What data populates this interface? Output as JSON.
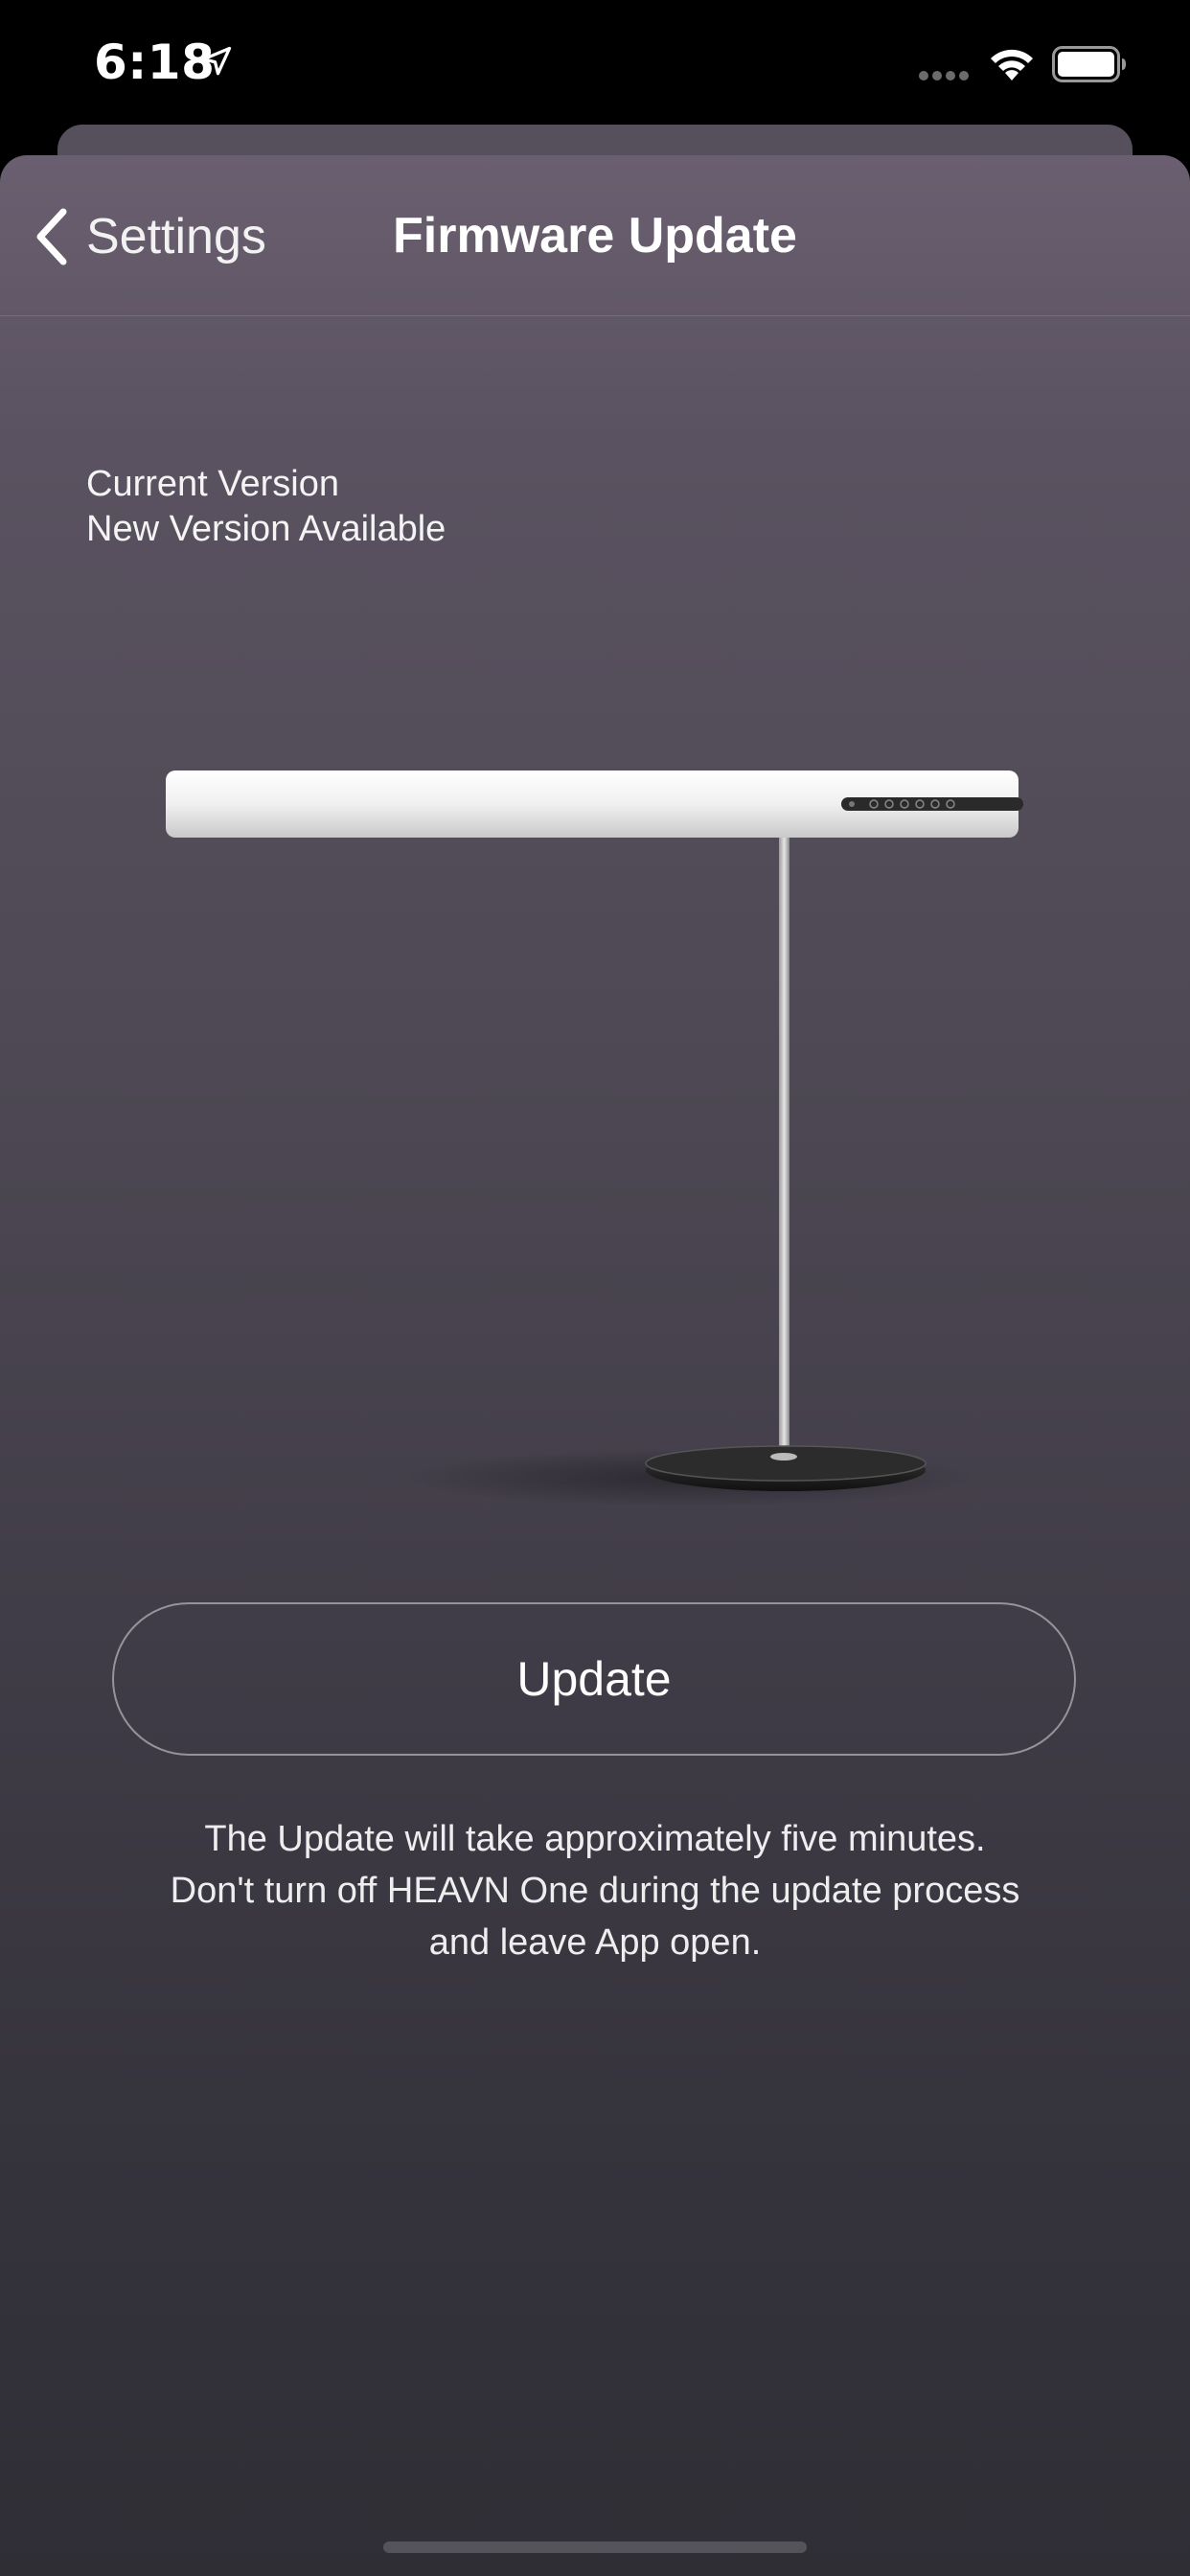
{
  "status_bar": {
    "time": "6:18"
  },
  "nav": {
    "back_label": "Settings",
    "title": "Firmware Update"
  },
  "firmware": {
    "current_version_label": "Current Version",
    "new_version_label": "New Version Available"
  },
  "update_button": {
    "label": "Update"
  },
  "info": {
    "line1": "The Update will take approximately five minutes.",
    "line2": "Don't turn off HEAVN One during the update process",
    "line3": "and leave App open."
  },
  "colors": {
    "background_top": "#6a5f70",
    "background_bottom": "#2f2e35",
    "text": "#ffffff"
  },
  "icons": [
    "location-arrow-icon",
    "cellular-signal-icon",
    "wifi-icon",
    "battery-icon",
    "chevron-left-icon"
  ]
}
